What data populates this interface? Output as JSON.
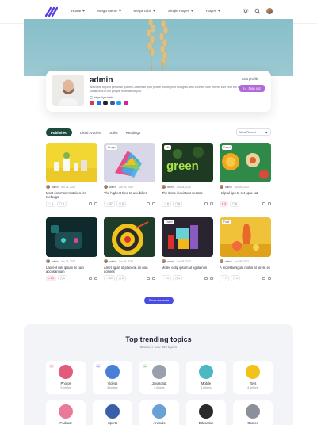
{
  "nav": {
    "items": [
      {
        "label": "Home"
      },
      {
        "label": "Mega Menu"
      },
      {
        "label": "Mega Tabs"
      },
      {
        "label": "Single Pages"
      },
      {
        "label": "Pages"
      }
    ]
  },
  "profile": {
    "name": "admin",
    "bio": "Welcome to your personal space! Customize your profile, share your thoughts, and connect with others. Edit your bio and add social links to tell people more about you.",
    "link": "https://your.site",
    "edit_label": "Edit profile",
    "signout_label": "Sign out"
  },
  "tabs": [
    {
      "label": "Published",
      "active": true
    },
    {
      "label": "Liked Articles"
    },
    {
      "label": "Drafts"
    },
    {
      "label": "Readings"
    }
  ],
  "sort": {
    "value": "Most Recent"
  },
  "cards": [
    {
      "tag": "",
      "author": "admin",
      "date": "Jun 25, 2022",
      "title": "Most common mistakes for Icebergs",
      "likes": "5",
      "comments": "6",
      "liked": false
    },
    {
      "tag": "Design",
      "author": "admin",
      "date": "Jun 25, 2022",
      "title": "The highest time to use bikes",
      "likes": "37",
      "comments": "5",
      "liked": false
    },
    {
      "tag": "Life",
      "author": "admin",
      "date": "Jun 25, 2022",
      "title": "The three inexistent sectors",
      "likes": "8",
      "comments": "6",
      "liked": false
    },
    {
      "tag": "Travel",
      "author": "admin",
      "date": "Jun 25, 2022",
      "title": "Helpful tips to set up a cat",
      "likes": "3",
      "comments": "6",
      "liked": true
    },
    {
      "tag": "",
      "author": "admin",
      "date": "Jun 25, 2022",
      "title": "Laoreet nisi ipsum at cum accusantium",
      "likes": "23",
      "comments": "6",
      "liked": true
    },
    {
      "tag": "",
      "author": "admin",
      "date": "Jun 25, 2022",
      "title": "Amet ligula ut placerat an non dolores",
      "likes": "59",
      "comments": "5",
      "liked": false
    },
    {
      "tag": "Travel",
      "author": "admin",
      "date": "Jun 25, 2022",
      "title": "Moles estip ipsum ut ligula non",
      "likes": "5",
      "comments": "6",
      "liked": false
    },
    {
      "tag": "Food",
      "author": "admin",
      "date": "Jun 25, 2022",
      "title": "A molestie ligula mollis at lorem ex",
      "likes": "7",
      "comments": "6",
      "liked": false
    }
  ],
  "show_more": "Show me more",
  "trending": {
    "title": "Top trending topics",
    "subtitle": "Discover over 100 topics",
    "topics": [
      {
        "name": "Photos",
        "count": "5 Articles",
        "badge": "#1",
        "color": "#e25b7a"
      },
      {
        "name": "Videos",
        "count": "8 Articles",
        "badge": "#2",
        "color": "#4a7fd8"
      },
      {
        "name": "Javascript",
        "count": "6 Articles",
        "badge": "#3",
        "color": "#9aa0ab"
      },
      {
        "name": "Mobile",
        "count": "6 Articles",
        "badge": "",
        "color": "#4cb8c4"
      },
      {
        "name": "Toys",
        "count": "8 Articles",
        "badge": "",
        "color": "#f2c21b"
      },
      {
        "name": "Podcast",
        "count": "",
        "badge": "",
        "color": "#e87a9a"
      },
      {
        "name": "Sports",
        "count": "",
        "badge": "",
        "color": "#3a5fa8"
      },
      {
        "name": "Animals",
        "count": "",
        "badge": "",
        "color": "#6aa0d4"
      },
      {
        "name": "Education",
        "count": "",
        "badge": "",
        "color": "#2a2a2a"
      },
      {
        "name": "Games",
        "count": "",
        "badge": "",
        "color": "#8a8f9a"
      }
    ]
  },
  "colors": {
    "accent": "#4a4ee0",
    "tab_active": "#1c4a3c",
    "signout": "#b06ad9",
    "like": "#e03a6a"
  }
}
